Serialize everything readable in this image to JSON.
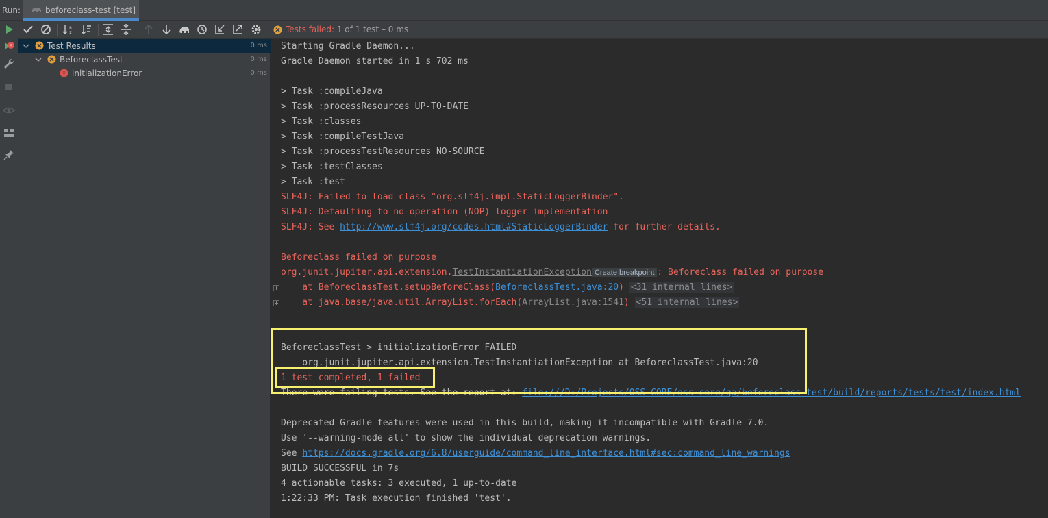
{
  "run_label": "Run:",
  "tab": {
    "title": "beforeclass-test [test]"
  },
  "status": {
    "prefix": "Tests failed:",
    "rest": " 1 of 1 test – 0 ms"
  },
  "colors": {
    "accent": "#4a88c7",
    "error": "#e8645a",
    "link": "#3d8fd6",
    "highlight": "#f7ef6e",
    "selection": "#0d293e"
  },
  "tree": [
    {
      "label": "Test Results",
      "time": "0 ms",
      "icon": "fail-icon"
    },
    {
      "label": "BeforeclassTest",
      "time": "0 ms",
      "icon": "fail-icon"
    },
    {
      "label": "initializationError",
      "time": "0 ms",
      "icon": "error-icon"
    }
  ],
  "console": {
    "l01": "Starting Gradle Daemon...",
    "l02": "Gradle Daemon started in 1 s 702 ms",
    "l03": "> Task :compileJava",
    "l04": "> Task :processResources UP-TO-DATE",
    "l05": "> Task :classes",
    "l06": "> Task :compileTestJava",
    "l07": "> Task :processTestResources NO-SOURCE",
    "l08": "> Task :testClasses",
    "l09": "> Task :test",
    "l10": "SLF4J: Failed to load class \"org.slf4j.impl.StaticLoggerBinder\".",
    "l11": "SLF4J: Defaulting to no-operation (NOP) logger implementation",
    "l12a": "SLF4J: See ",
    "l12link": "http://www.slf4j.org/codes.html#StaticLoggerBinder",
    "l12b": " for further details.",
    "l13": "Beforeclass failed on purpose",
    "l14a": "org.junit.jupiter.api.extension.",
    "l14link": "TestInstantiationException",
    "l14tip": "Create breakpoint",
    "l14b": ": Beforeclass failed on purpose",
    "l15a": "    at BeforeclassTest.setupBeforeClass(",
    "l15link": "BeforeclassTest.java:20",
    "l15b": ")",
    "l15int": "<31 internal lines>",
    "l16a": "    at java.base/java.util.ArrayList.forEach(",
    "l16link": "ArrayList.java:1541",
    "l16b": ")",
    "l16int": "<51 internal lines>",
    "l17": "BeforeclassTest > initializationError FAILED",
    "l18": "    org.junit.jupiter.api.extension.TestInstantiationException at BeforeclassTest.java:20",
    "l19": "1 test completed, 1 failed",
    "l20a": "There were failing tests. See the report at: ",
    "l20link": "file:///D:/Projects/OSS-CORE/oss-core/qa/beforeclass-test/build/reports/tests/test/index.html",
    "l21": "Deprecated Gradle features were used in this build, making it incompatible with Gradle 7.0.",
    "l22": "Use '--warning-mode all' to show the individual deprecation warnings.",
    "l23a": "See ",
    "l23link": "https://docs.gradle.org/6.8/userguide/command_line_interface.html#sec:command_line_warnings",
    "l24": "BUILD SUCCESSFUL in 7s",
    "l25": "4 actionable tasks: 3 executed, 1 up-to-date",
    "l26": "1:22:33 PM: Task execution finished 'test'."
  }
}
